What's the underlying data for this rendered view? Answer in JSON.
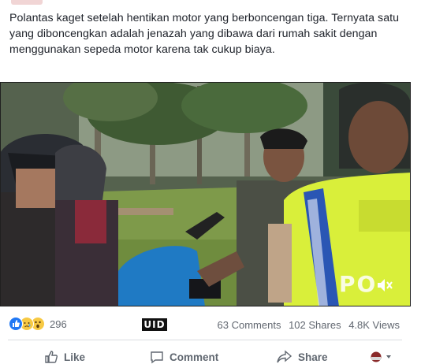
{
  "post": {
    "text": "Polantas kaget setelah hentikan motor yang berboncengan tiga. Ternyata satu yang diboncengkan adalah jenazah yang dibawa dari rumah sakit dengan menggunakan sepeda motor karena tak cukup biaya."
  },
  "video": {
    "vest_text": "PO",
    "sound_icon": "speaker-muted-icon"
  },
  "stats": {
    "reaction_icons": [
      "like-reaction-icon",
      "sad-reaction-icon",
      "wow-reaction-icon"
    ],
    "reaction_count": "296",
    "watermark": "UID",
    "comments": "63 Comments",
    "shares": "102 Shares",
    "views": "4.8K Views"
  },
  "actions": {
    "like": "Like",
    "comment": "Comment",
    "share": "Share"
  },
  "colors": {
    "like_blue": "#2078f4",
    "text": "#1d2129",
    "muted": "#616770",
    "vest_yellow": "#d9ef3a"
  }
}
